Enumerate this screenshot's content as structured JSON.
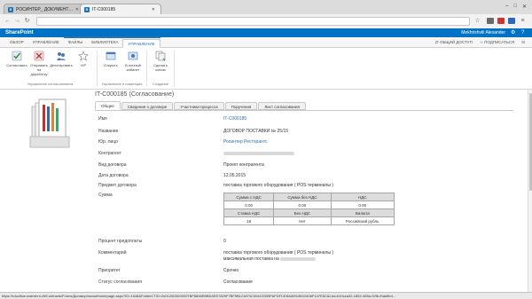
{
  "browser": {
    "tabs": [
      {
        "label": "РОСИНТЕР_ ДОКУМЕНТО...",
        "active": false,
        "favicon": "S"
      },
      {
        "label": "IT-C000185",
        "active": true,
        "favicon": "S"
      }
    ]
  },
  "suitebar": {
    "brand": "SharePoint",
    "user": "Mekhrishvili Alexander"
  },
  "ribbon_tabs": {
    "items": [
      "ОБЗОР",
      "УПРАВЛЕНИЕ",
      "ФАЙЛЫ",
      "БИБЛИОТЕКА"
    ],
    "context_tab": "УПРАВЛЕНИЕ",
    "share": "ОБЩИЙ ДОСТУП",
    "follow": "ПОДПИСАТЬСЯ"
  },
  "ribbon": {
    "group1": {
      "label": "Управление согласованием",
      "buttons": [
        "Согласовать",
        "Отправить на доработку",
        "Делегировать",
        "VIP"
      ]
    },
    "group2": {
      "label": "Управление и навигация",
      "buttons": [
        "Открыть",
        "В личный кабинет"
      ]
    },
    "group3": {
      "label": "Создание",
      "buttons": [
        "Сделать копию"
      ]
    }
  },
  "page": {
    "title": "IT-C000185 (Согласование)",
    "form_tabs": [
      "Общее",
      "Сведения о договоре",
      "Участники процесса",
      "Поручения",
      "Лист согласования"
    ]
  },
  "fields": [
    {
      "label": "Имя",
      "value": "IT-C000185",
      "link": true
    },
    {
      "label": "Название",
      "value": "ДОГОВОР ПОСТАВКИ № 25/15"
    },
    {
      "label": "Юр. лицо",
      "value": "Росинтер Ресторантс",
      "link": true
    },
    {
      "label": "Контрагент",
      "value": ""
    },
    {
      "label": "Вид договора",
      "value": "Проект контрагента"
    },
    {
      "label": "Дата договора",
      "value": "12.05.2015"
    },
    {
      "label": "Предмет договора",
      "value": "поставка торгового оборудования ( POS терминалы )"
    },
    {
      "label": "Сумма",
      "value": ""
    }
  ],
  "sum_table": {
    "headers1": [
      "Сумма с НДС",
      "Сумма без НДС",
      "НДС"
    ],
    "row1": [
      "0.00",
      "0.00",
      "0.00"
    ],
    "headers2": [
      "Ставка НДС",
      "Без НДС",
      "Валюта"
    ],
    "row2": [
      "18",
      "Нет",
      "Российский рубль"
    ]
  },
  "fields_lower": [
    {
      "label": "Процент предоплаты",
      "value": "0"
    },
    {
      "label": "Комментарий",
      "value": "поставка торгового оборудования ( POS терминалы )",
      "value2": "максимальная поставка на"
    },
    {
      "label": "Приоритет",
      "value": "Срочно"
    },
    {
      "label": "Статус согласования",
      "value": "Согласование"
    }
  ],
  "statusbar": "https://rdocflow.rosinter.ru/it/Contracts/Forms/Договор/docsethomepage.aspx?ID=1648&FolderCTID=0x0120D5200097BF8836EBBD4EE7829F7BF9B121874C004C5339FAFDFCE8448910B10406F147E5C&List=b10cca32-1852-465a-92fb-f0ab8b4..."
}
